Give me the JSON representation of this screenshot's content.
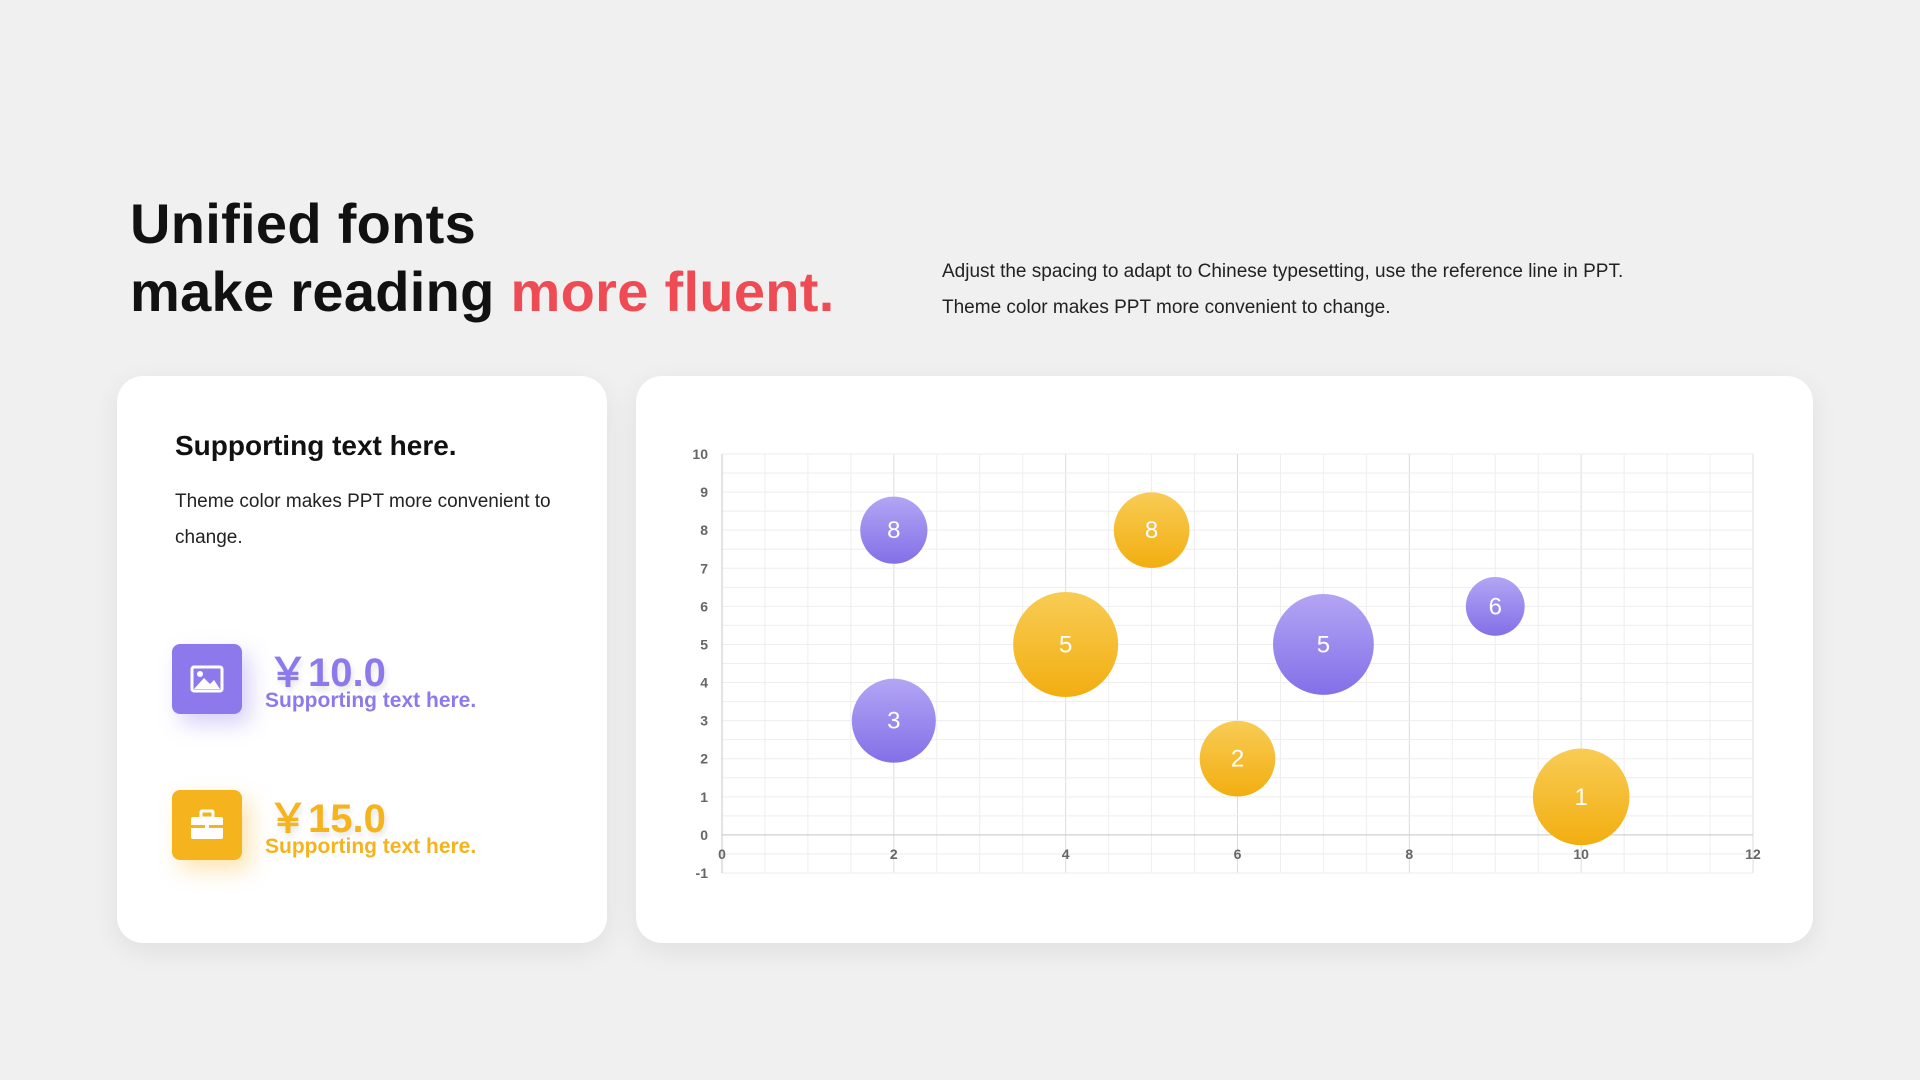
{
  "header": {
    "title_line1": "Unified fonts",
    "title_line2_plain": "make reading ",
    "title_line2_accent": "more fluent.",
    "desc_line1": "Adjust the spacing to adapt to Chinese typesetting, use the reference line in PPT.",
    "desc_line2": "Theme color makes PPT more convenient to change."
  },
  "left_card": {
    "title": "Supporting text here.",
    "text": "Theme color makes PPT more convenient to change.",
    "stats": [
      {
        "value": "￥10.0",
        "label": "Supporting text here.",
        "icon": "image-icon",
        "color": "#8e79ec"
      },
      {
        "value": "￥15.0",
        "label": "Supporting text here.",
        "icon": "briefcase-icon",
        "color": "#f5b31d"
      }
    ]
  },
  "colors": {
    "accent_red": "#ee4b55",
    "purple": "#8e79ec",
    "yellow": "#f5b31d",
    "background": "#f0f0f0"
  },
  "chart_data": {
    "type": "scatter",
    "subtype": "bubble",
    "xlim": [
      0,
      12
    ],
    "ylim": [
      -1,
      10
    ],
    "x_ticks": [
      0,
      2,
      4,
      6,
      8,
      10,
      12
    ],
    "y_ticks": [
      -1,
      0,
      1,
      2,
      3,
      4,
      5,
      6,
      7,
      8,
      9,
      10
    ],
    "grid": true,
    "series": [
      {
        "color": "#8e79ec",
        "points": [
          {
            "x": 2,
            "y": 8,
            "size": 8
          },
          {
            "x": 2,
            "y": 3,
            "size": 10
          },
          {
            "x": 7,
            "y": 5,
            "size": 12
          },
          {
            "x": 9,
            "y": 6,
            "size": 7
          }
        ]
      },
      {
        "color": "#f5b31d",
        "points": [
          {
            "x": 5,
            "y": 8,
            "size": 9
          },
          {
            "x": 4,
            "y": 5,
            "size": 12.5
          },
          {
            "x": 6,
            "y": 2,
            "size": 9
          },
          {
            "x": 10,
            "y": 1,
            "size": 11.5
          }
        ]
      }
    ],
    "bubble_labels": [
      "8",
      "3",
      "5",
      "6",
      "8",
      "5",
      "2",
      "1"
    ]
  }
}
